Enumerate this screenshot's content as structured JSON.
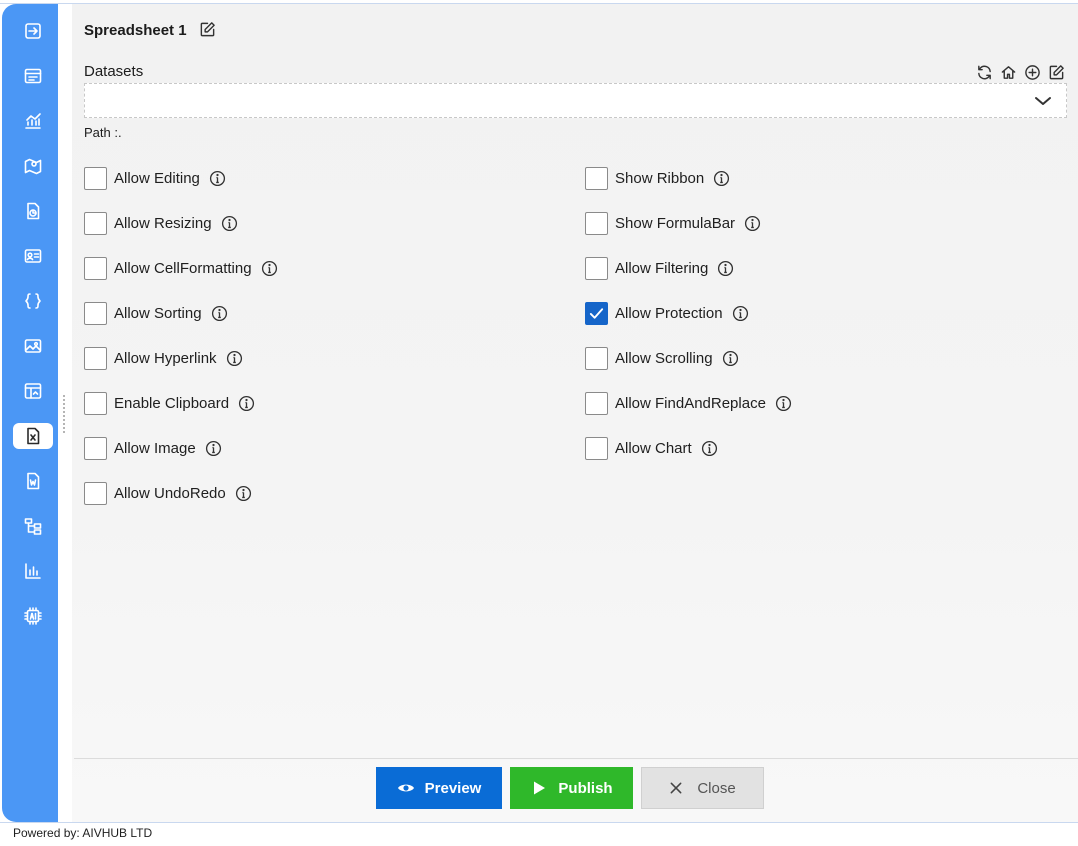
{
  "sidebar": {
    "items": [
      {
        "icon": "sign-in-icon",
        "active": false
      },
      {
        "icon": "table-icon",
        "active": false
      },
      {
        "icon": "chart-icon",
        "active": false
      },
      {
        "icon": "map-icon",
        "active": false
      },
      {
        "icon": "document-chart-icon",
        "active": false
      },
      {
        "icon": "id-card-icon",
        "active": false
      },
      {
        "icon": "braces-icon",
        "active": false
      },
      {
        "icon": "image-icon",
        "active": false
      },
      {
        "icon": "dashboard-icon",
        "active": false
      },
      {
        "icon": "excel-icon",
        "active": true
      },
      {
        "icon": "word-icon",
        "active": false
      },
      {
        "icon": "tree-icon",
        "active": false
      },
      {
        "icon": "bar-chart-icon",
        "active": false
      },
      {
        "icon": "ai-chip-icon",
        "active": false
      }
    ]
  },
  "header": {
    "title": "Spreadsheet 1"
  },
  "datasets": {
    "label": "Datasets",
    "selected": "",
    "path_label": "Path :."
  },
  "options": {
    "left": [
      {
        "label": "Allow Editing",
        "checked": false
      },
      {
        "label": "Allow Resizing",
        "checked": false
      },
      {
        "label": "Allow CellFormatting",
        "checked": false
      },
      {
        "label": "Allow Sorting",
        "checked": false
      },
      {
        "label": "Allow Hyperlink",
        "checked": false
      },
      {
        "label": "Enable Clipboard",
        "checked": false
      },
      {
        "label": "Allow Image",
        "checked": false
      },
      {
        "label": "Allow UndoRedo",
        "checked": false
      }
    ],
    "right": [
      {
        "label": "Show Ribbon",
        "checked": false
      },
      {
        "label": "Show FormulaBar",
        "checked": false
      },
      {
        "label": "Allow Filtering",
        "checked": false
      },
      {
        "label": "Allow Protection",
        "checked": true
      },
      {
        "label": "Allow Scrolling",
        "checked": false
      },
      {
        "label": "Allow FindAndReplace",
        "checked": false
      },
      {
        "label": "Allow Chart",
        "checked": false
      }
    ]
  },
  "footer": {
    "preview_label": "Preview",
    "publish_label": "Publish",
    "close_label": "Close"
  },
  "powered_by": "Powered by: AIVHUB LTD",
  "colors": {
    "sidebar": "#4b97f5",
    "checkbox_checked": "#1565c9",
    "preview": "#0a6cd6",
    "publish": "#2fb82a",
    "close": "#e2e2e2"
  }
}
